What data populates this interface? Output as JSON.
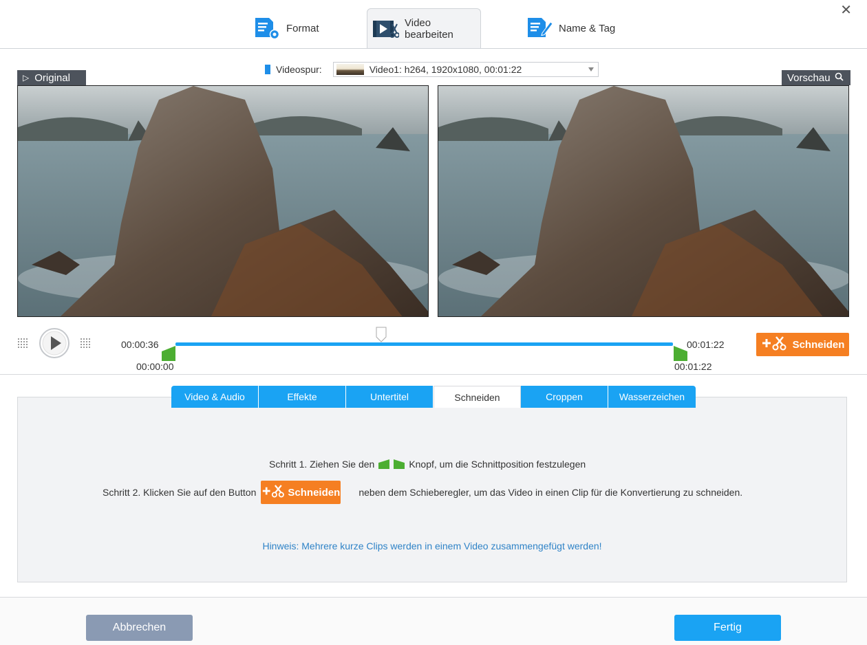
{
  "top_tabs": [
    {
      "label": "Format",
      "icon": "format-settings-icon"
    },
    {
      "label": "Video bearbeiten",
      "icon": "video-edit-icon"
    },
    {
      "label": "Name & Tag",
      "icon": "name-tag-edit-icon"
    }
  ],
  "track": {
    "label": "Videospur:",
    "selected": "Video1: h264, 1920x1080, 00:01:22"
  },
  "panels": {
    "original_label": "Original",
    "preview_label": "Vorschau"
  },
  "timeline": {
    "current_time": "00:00:36",
    "start_time": "00:00:00",
    "end_time_top": "00:01:22",
    "end_time_bottom": "00:01:22",
    "playhead_fraction": 0.414,
    "cut_button": "Schneiden"
  },
  "sub_tabs": [
    "Video & Audio",
    "Effekte",
    "Untertitel",
    "Schneiden",
    "Croppen",
    "Wasserzeichen"
  ],
  "active_sub_tab": "Schneiden",
  "instructions": {
    "step1_pre": "Schritt 1. Ziehen Sie den",
    "step1_post": "Knopf, um die Schnittposition festzulegen",
    "step2_pre": "Schritt 2. Klicken Sie auf den Button",
    "step2_btn": "Schneiden",
    "step2_post": "neben dem Schieberegler, um das Video in einen Clip für die Konvertierung zu schneiden.",
    "hint": "Hinweis: Mehrere kurze Clips werden in einem Video zusammengefügt werden!"
  },
  "footer": {
    "cancel": "Abbrechen",
    "done": "Fertig"
  },
  "colors": {
    "accent_blue": "#1aa3f3",
    "cut_orange": "#f57f22",
    "handle_green": "#4cae32",
    "cancel_gray": "#8a9ab3"
  }
}
